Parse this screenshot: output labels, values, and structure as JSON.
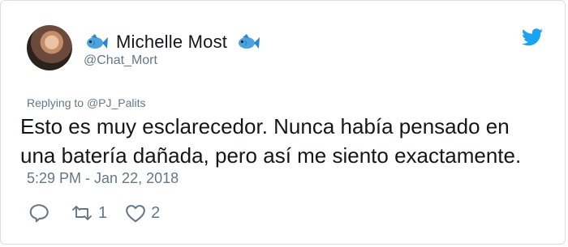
{
  "user": {
    "display_name": "Michelle Most",
    "handle": "@Chat_Mort"
  },
  "reply": {
    "prefix": "Replying to",
    "target": "@PJ_Palits"
  },
  "tweet": {
    "text_line1": "Esto es muy esclarecedor. Nunca había pensado en",
    "text_line2": "una batería dañada, pero así me siento exactamente.",
    "timestamp": "5:29 PM - Jan 22, 2018"
  },
  "stats": {
    "retweets": "1",
    "likes": "2"
  },
  "icons": {
    "brand": "twitter-bird-icon",
    "emoji": "fish-icon",
    "reply": "reply-icon",
    "retweet": "retweet-icon",
    "like": "heart-icon"
  },
  "colors": {
    "twitter_blue": "#1da1f2",
    "text": "#14171a",
    "secondary": "#657786",
    "fish": "#4aa3df"
  }
}
